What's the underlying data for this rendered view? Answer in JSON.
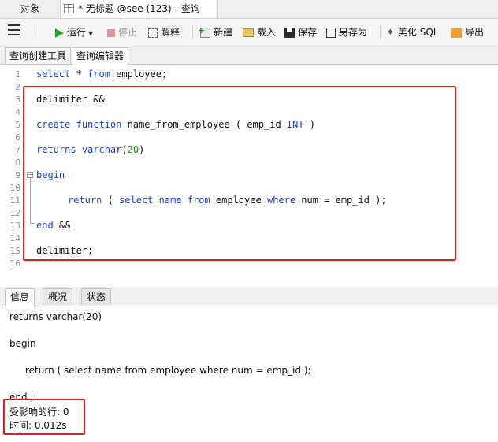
{
  "window_tabs": {
    "objects": "对象",
    "query_tab": "* 无标题 @see (123) - 查询"
  },
  "toolbar": {
    "run": "运行",
    "stop": "停止",
    "explain": "解释",
    "new": "新建",
    "load": "载入",
    "save": "保存",
    "save_as": "另存为",
    "beautify": "美化 SQL",
    "export": "导出"
  },
  "editor_tabs": {
    "query_builder": "查询创建工具",
    "query_editor": "查询编辑器"
  },
  "editor": {
    "line_numbers": [
      "1",
      "2",
      "3",
      "4",
      "5",
      "6",
      "7",
      "8",
      "9",
      "10",
      "11",
      "12",
      "13",
      "14",
      "15",
      "16"
    ],
    "lines": {
      "l1": {
        "kw1": "select",
        "t1": " * ",
        "kw2": "from",
        "t2": " employee;"
      },
      "l3": {
        "t1": "delimiter &&"
      },
      "l5": {
        "kw1": "create",
        "t1": " ",
        "kw2": "function",
        "t2": " name_from_employee ( emp_id ",
        "kw3": "INT",
        "t3": " )"
      },
      "l7": {
        "kw1": "returns",
        "t1": " ",
        "kw2": "varchar",
        "t2": "(",
        "num": "20",
        "t3": ")"
      },
      "l9": {
        "kw1": "begin"
      },
      "l11": {
        "kw1": "return",
        "t1": " ( ",
        "kw2": "select",
        "t2": " ",
        "kw3": "name",
        "t3": " ",
        "kw4": "from",
        "t4": " employee ",
        "kw5": "where",
        "t5": " num = emp_id );"
      },
      "l13": {
        "kw1": "end",
        "t1": " &&"
      },
      "l15": {
        "t1": "delimiter;"
      }
    }
  },
  "bottom_tabs": {
    "info": "信息",
    "overview": "概况",
    "status": "状态"
  },
  "output": {
    "line1": "returns varchar(20)",
    "line2": "begin",
    "line3": "return ( select name from employee where num = emp_id );",
    "line4": "end ;",
    "affected": "受影响的行: 0",
    "time": "时间: 0.012s"
  },
  "colors": {
    "keyword": "#1b3fd6",
    "number": "#1f8f1f",
    "highlight_box": "#e02020",
    "run_icon": "#2aa52a"
  },
  "icons": [
    "menu-icon",
    "table-icon",
    "run-icon",
    "stop-icon",
    "explain-icon",
    "new-icon",
    "load-icon",
    "save-icon",
    "save-as-icon",
    "beautify-icon",
    "export-icon"
  ]
}
